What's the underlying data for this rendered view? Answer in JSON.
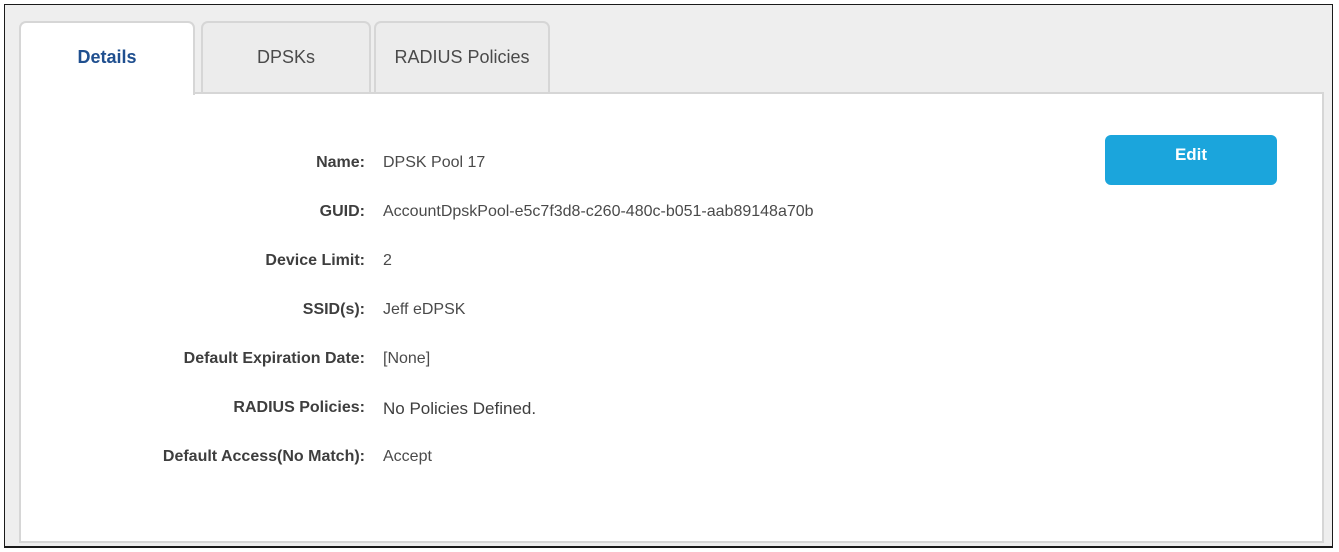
{
  "tabs": [
    {
      "label": "Details",
      "active": true
    },
    {
      "label": "DPSKs",
      "active": false
    },
    {
      "label": "RADIUS Policies",
      "active": false
    }
  ],
  "edit_button": {
    "label": "Edit"
  },
  "details": [
    {
      "label": "Name:",
      "value": "DPSK Pool 17"
    },
    {
      "label": "GUID:",
      "value": "AccountDpskPool-e5c7f3d8-c260-480c-b051-aab89148a70b"
    },
    {
      "label": "Device Limit:",
      "value": "2"
    },
    {
      "label": "SSID(s):",
      "value": "Jeff eDPSK"
    },
    {
      "label": "Default Expiration Date:",
      "value": "[None]"
    },
    {
      "label": "RADIUS Policies:",
      "value": "No Policies Defined."
    },
    {
      "label": "Default Access(No Match):",
      "value": "Accept"
    }
  ],
  "colors": {
    "accent_button": "#1ba5dc",
    "active_tab_text": "#1f4f8f",
    "border": "#d6d6d6"
  }
}
